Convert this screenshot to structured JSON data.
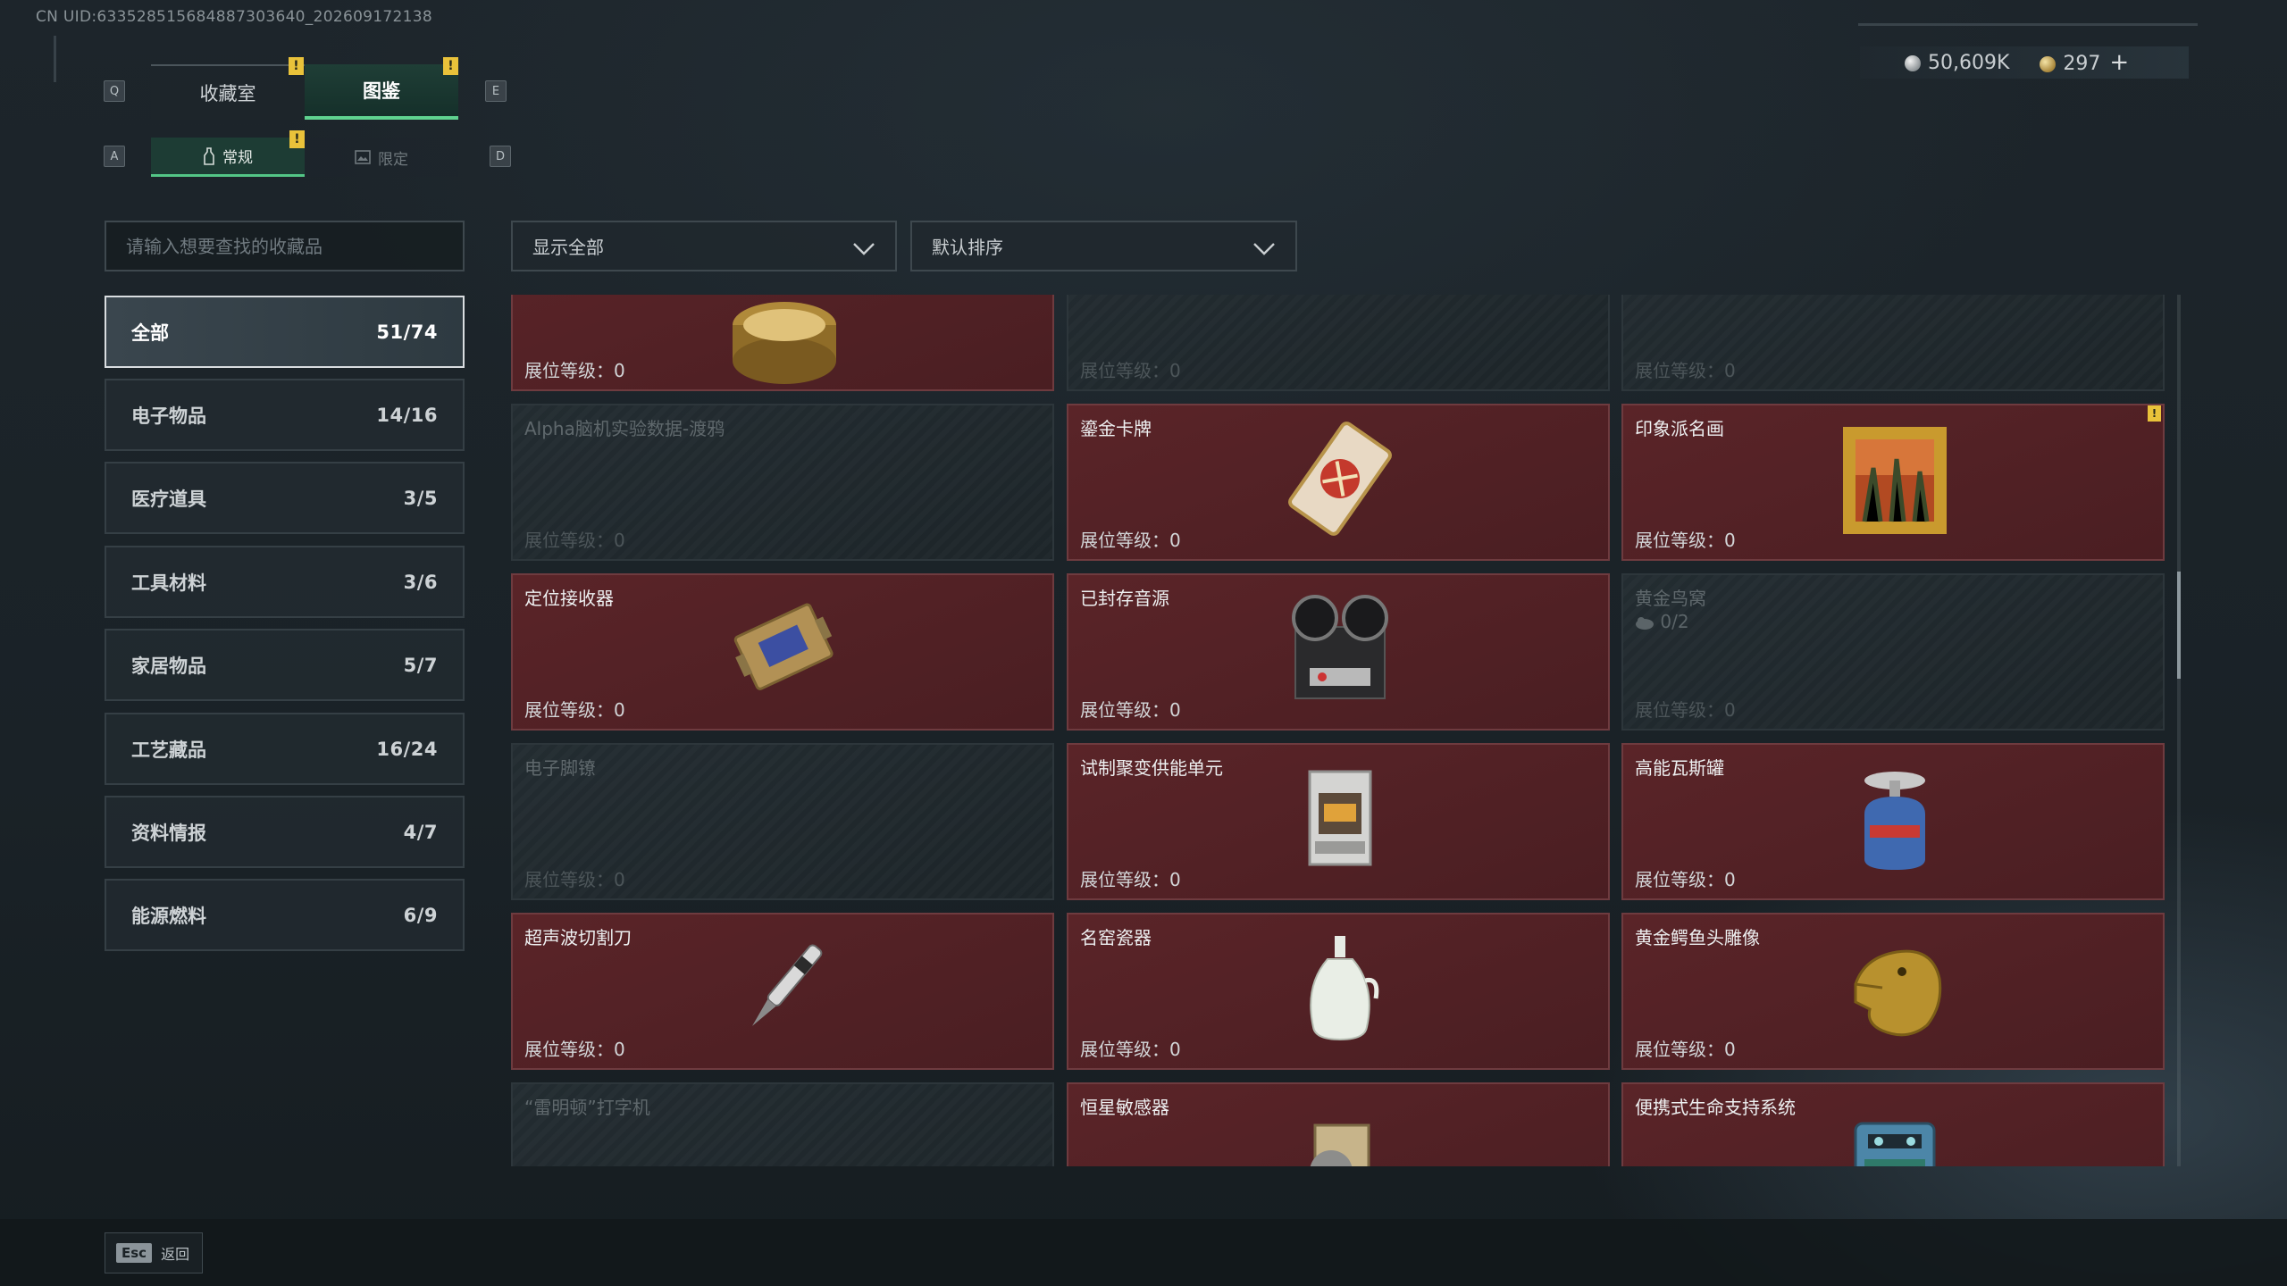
{
  "uid": "CN UID:633528515684887303640_202609172138",
  "currency": {
    "silver": "50,609K",
    "gold": "297",
    "add": "+"
  },
  "keys": {
    "prev_tab": "Q",
    "next_tab": "E",
    "prev_sub": "A",
    "next_sub": "D",
    "esc": "Esc"
  },
  "tabs": {
    "collection": "收藏室",
    "codex": "图鉴",
    "warn": "!"
  },
  "subtabs": {
    "normal": "常规",
    "limited": "限定"
  },
  "search": {
    "placeholder": "请输入想要查找的收藏品"
  },
  "filters": {
    "show": "显示全部",
    "sort": "默认排序"
  },
  "categories": [
    {
      "label": "全部",
      "count": "51/74"
    },
    {
      "label": "电子物品",
      "count": "14/16"
    },
    {
      "label": "医疗道具",
      "count": "3/5"
    },
    {
      "label": "工具材料",
      "count": "3/6"
    },
    {
      "label": "家居物品",
      "count": "5/7"
    },
    {
      "label": "工艺藏品",
      "count": "16/24"
    },
    {
      "label": "资料情报",
      "count": "4/7"
    },
    {
      "label": "能源燃料",
      "count": "6/9"
    }
  ],
  "level_label": "展位等级：0",
  "items": [
    {
      "name": "",
      "owned": true,
      "icon": "caviar-tin-icon"
    },
    {
      "name": "",
      "owned": false,
      "icon": ""
    },
    {
      "name": "",
      "owned": false,
      "icon": ""
    },
    {
      "name": "Alpha脑机实验数据-渡鸦",
      "owned": false,
      "icon": ""
    },
    {
      "name": "鎏金卡牌",
      "owned": true,
      "icon": "gilded-card-icon"
    },
    {
      "name": "印象派名画",
      "owned": true,
      "icon": "painting-icon",
      "warn": true
    },
    {
      "name": "定位接收器",
      "owned": true,
      "icon": "receiver-icon"
    },
    {
      "name": "已封存音源",
      "owned": true,
      "icon": "reel-recorder-icon"
    },
    {
      "name": "黄金鸟窝",
      "owned": false,
      "icon": "",
      "sub": "0/2"
    },
    {
      "name": "电子脚镣",
      "owned": false,
      "icon": ""
    },
    {
      "name": "试制聚变供能单元",
      "owned": true,
      "icon": "fusion-unit-icon"
    },
    {
      "name": "高能瓦斯罐",
      "owned": true,
      "icon": "gas-canister-icon"
    },
    {
      "name": "超声波切割刀",
      "owned": true,
      "icon": "ultrasonic-knife-icon"
    },
    {
      "name": "名窑瓷器",
      "owned": true,
      "icon": "porcelain-vase-icon"
    },
    {
      "name": "黄金鳄鱼头雕像",
      "owned": true,
      "icon": "gold-crocodile-icon"
    },
    {
      "name": "“雷明顿”打字机",
      "owned": false,
      "icon": ""
    },
    {
      "name": "恒星敏感器",
      "owned": true,
      "icon": "star-sensor-icon"
    },
    {
      "name": "便携式生命支持系统",
      "owned": true,
      "icon": "life-support-icon"
    }
  ],
  "back_label": "返回"
}
